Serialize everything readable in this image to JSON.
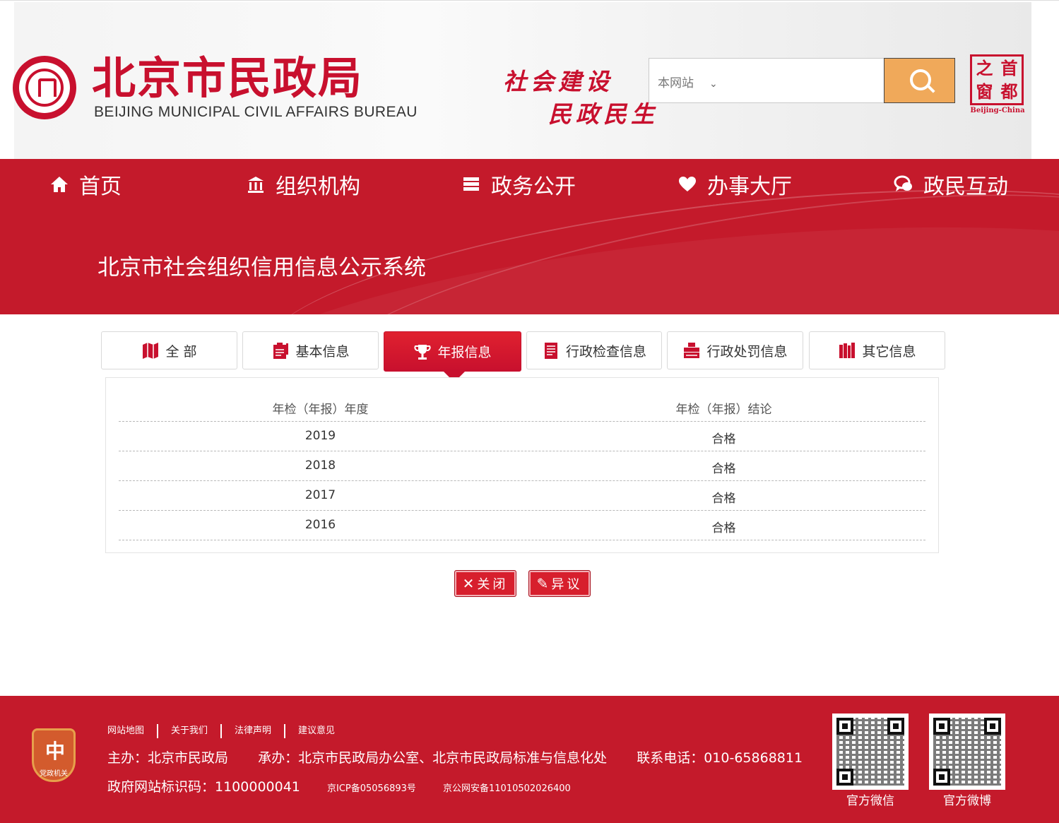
{
  "header": {
    "logo_cn": "北京市民政局",
    "logo_en": "BEIJING MUNICIPAL CIVIL AFFAIRS BUREAU",
    "slogan_line1": "社会建设",
    "slogan_line2": "民政民生",
    "search": {
      "scope": "本网站",
      "placeholder": ""
    },
    "capital_badge": {
      "chars": [
        "之",
        "首",
        "窗",
        "都"
      ],
      "subtitle": "Beijing-China"
    }
  },
  "nav": [
    {
      "label": "首页",
      "icon": "home-icon"
    },
    {
      "label": "组织机构",
      "icon": "building-icon"
    },
    {
      "label": "政务公开",
      "icon": "list-icon"
    },
    {
      "label": "办事大厅",
      "icon": "heart-icon"
    },
    {
      "label": "政民互动",
      "icon": "chat-icon"
    }
  ],
  "banner": {
    "title": "北京市社会组织信用信息公示系统"
  },
  "tabs": [
    {
      "label": "全 部",
      "icon": "map-icon",
      "active": false
    },
    {
      "label": "基本信息",
      "icon": "clipboard-icon",
      "active": false
    },
    {
      "label": "年报信息",
      "icon": "trophy-icon",
      "active": true
    },
    {
      "label": "行政检查信息",
      "icon": "document-icon",
      "active": false
    },
    {
      "label": "行政处罚信息",
      "icon": "stamp-icon",
      "active": false
    },
    {
      "label": "其它信息",
      "icon": "books-icon",
      "active": false
    }
  ],
  "table": {
    "headers": [
      "年检（年报）年度",
      "年检（年报）结论"
    ],
    "rows": [
      [
        "2019",
        "合格"
      ],
      [
        "2018",
        "合格"
      ],
      [
        "2017",
        "合格"
      ],
      [
        "2016",
        "合格"
      ]
    ]
  },
  "buttons": {
    "close": "关闭",
    "objection": "异议"
  },
  "footer": {
    "emblem_text": "党政机关",
    "links": [
      "网站地图",
      "关于我们",
      "法律声明",
      "建议意见"
    ],
    "sponsor": "主办：北京市民政局",
    "organizer": "承办：北京市民政局办公室、北京市民政局标准与信息化处",
    "phone": "联系电话：010-65868811",
    "site_id": "政府网站标识码：1100000041",
    "icp": "京ICP备05056893号",
    "police": "京公网安备11010502026400",
    "qr_wechat": "官方微信",
    "qr_weibo": "官方微博"
  },
  "colors": {
    "brand_red": "#c41a2b",
    "search_orange": "#f0a95a"
  }
}
